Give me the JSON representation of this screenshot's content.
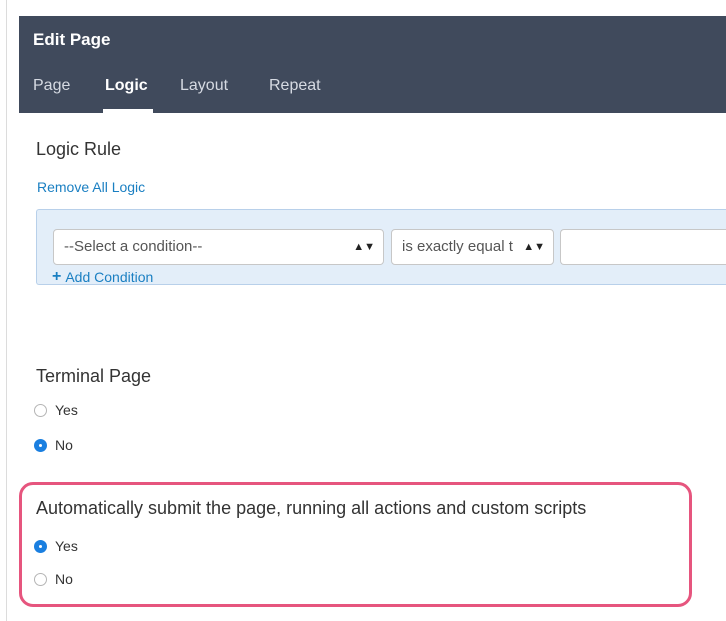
{
  "header": {
    "title": "Edit Page",
    "tabs": [
      {
        "label": "Page",
        "active": false
      },
      {
        "label": "Logic",
        "active": true
      },
      {
        "label": "Layout",
        "active": false
      },
      {
        "label": "Repeat",
        "active": false
      }
    ]
  },
  "logic_rule": {
    "title": "Logic Rule",
    "remove_link": "Remove All Logic",
    "condition_select": "--Select a condition--",
    "operator_select": "is exactly equal t",
    "value_input": "",
    "add_condition": "Add Condition"
  },
  "terminal_page": {
    "title": "Terminal Page",
    "options": [
      {
        "label": "Yes",
        "checked": false
      },
      {
        "label": "No",
        "checked": true
      }
    ]
  },
  "auto_submit": {
    "title": "Automatically submit the page, running all actions and custom scripts",
    "options": [
      {
        "label": "Yes",
        "checked": true
      },
      {
        "label": "No",
        "checked": false
      }
    ]
  },
  "colors": {
    "header_bg": "#404a5c",
    "link": "#1a7fc2",
    "radio_checked": "#1a7fe0",
    "highlight": "#e6557e",
    "logic_box_bg": "#e3eef9"
  }
}
